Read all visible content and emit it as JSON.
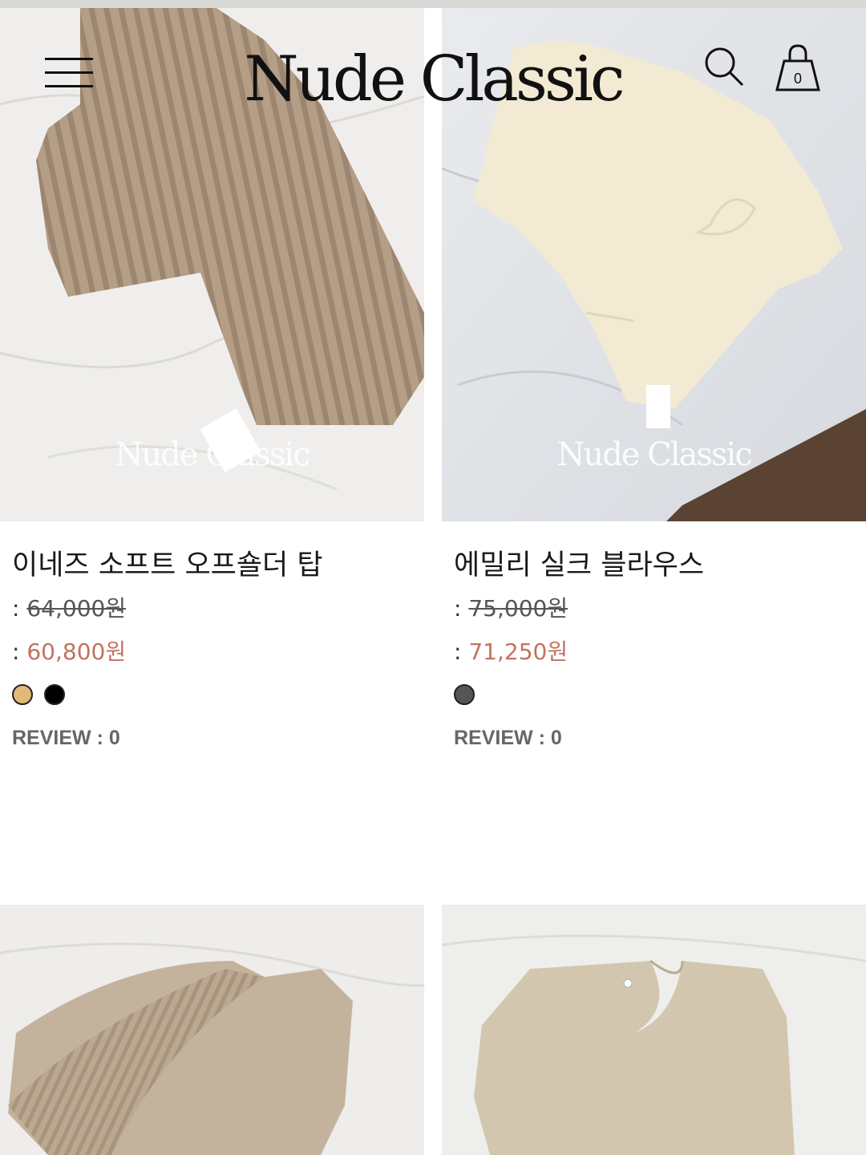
{
  "header": {
    "logo": "Nude Classic",
    "cart_count": "0"
  },
  "products": [
    {
      "name": "이네즈 소프트 오프숄더 탑",
      "colon": ":",
      "original_price": "64,000원",
      "sale_price": "60,800원",
      "swatches": [
        "#e2b97a",
        "#000000"
      ],
      "review_label": "REVIEW : 0",
      "watermark": "Nude Classic"
    },
    {
      "name": "에밀리 실크 블라우스",
      "colon": ":",
      "original_price": "75,000원",
      "sale_price": "71,250원",
      "swatches": [
        "#555555"
      ],
      "review_label": "REVIEW : 0",
      "watermark": "Nude Classic"
    }
  ],
  "colors": {
    "sale": "#c4725f",
    "original": "#555555",
    "review": "#666666"
  },
  "icons": {
    "menu": "hamburger-menu-icon",
    "search": "search-icon",
    "cart": "shopping-bag-icon"
  }
}
